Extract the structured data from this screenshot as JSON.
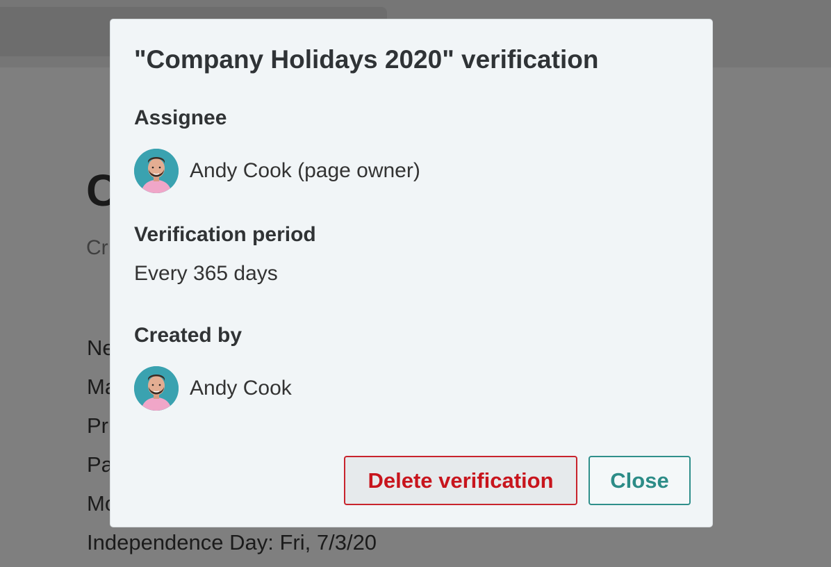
{
  "background_page": {
    "title_fragment": "C",
    "subtitle_fragment": "Cr",
    "list_fragments": [
      "Ne",
      "Ma",
      "Pr",
      "Pa",
      "Mo"
    ],
    "last_line": "Independence Day: Fri, 7/3/20"
  },
  "modal": {
    "title": "\"Company Holidays 2020\" verification",
    "assignee": {
      "label": "Assignee",
      "name": "Andy Cook (page owner)"
    },
    "period": {
      "label": "Verification period",
      "value": "Every 365 days"
    },
    "created_by": {
      "label": "Created by",
      "name": "Andy Cook"
    },
    "buttons": {
      "delete": "Delete verification",
      "close": "Close"
    }
  },
  "colors": {
    "danger": "#c8151d",
    "accent": "#2c8c87",
    "avatar_bg": "#3aa2b0"
  }
}
